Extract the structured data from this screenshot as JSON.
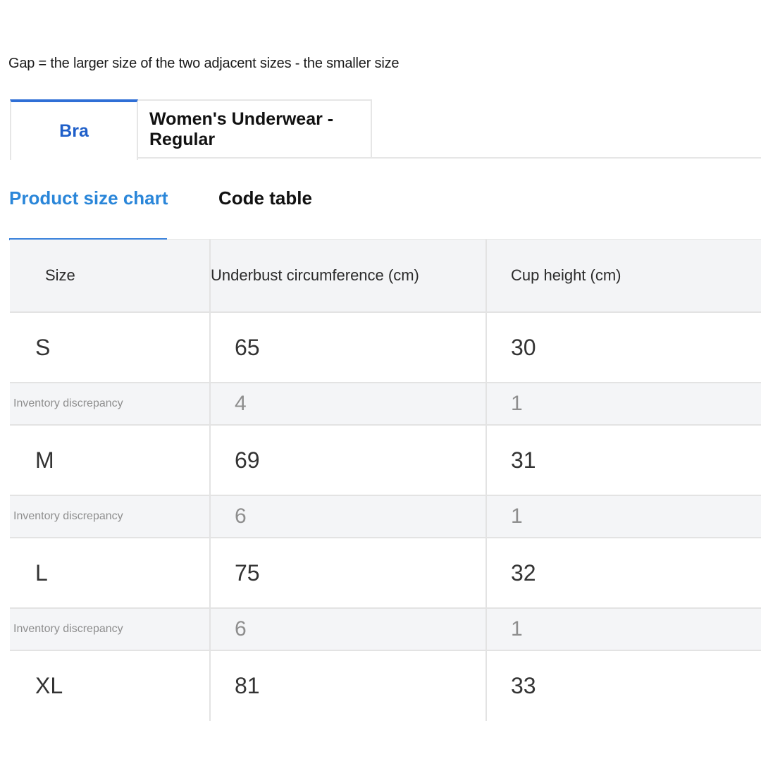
{
  "note": "Gap = the larger size of the two adjacent sizes - the smaller size",
  "category_tabs": [
    {
      "label": "Bra",
      "active": true
    },
    {
      "label": "Women's Underwear - Regular",
      "active": false
    }
  ],
  "sub_tabs": [
    {
      "label": "Product size chart",
      "active": true
    },
    {
      "label": "Code table",
      "active": false
    }
  ],
  "colors": {
    "active_tab": "#1f5fc9",
    "active_subtab": "#2a86d9",
    "header_bg": "#f3f4f6",
    "gap_row_bg": "#f4f5f7"
  },
  "table": {
    "headers": [
      "Size",
      "Underbust circumference (cm)",
      "Cup height (cm)"
    ],
    "rows": [
      {
        "type": "size",
        "cells": [
          "S",
          "65",
          "30"
        ]
      },
      {
        "type": "gap",
        "cells": [
          "Inventory discrepancy",
          "4",
          "1"
        ]
      },
      {
        "type": "size",
        "cells": [
          "M",
          "69",
          "31"
        ]
      },
      {
        "type": "gap",
        "cells": [
          "Inventory discrepancy",
          "6",
          "1"
        ]
      },
      {
        "type": "size",
        "cells": [
          "L",
          "75",
          "32"
        ]
      },
      {
        "type": "gap",
        "cells": [
          "Inventory discrepancy",
          "6",
          "1"
        ]
      },
      {
        "type": "size",
        "cells": [
          "XL",
          "81",
          "33"
        ]
      }
    ]
  }
}
